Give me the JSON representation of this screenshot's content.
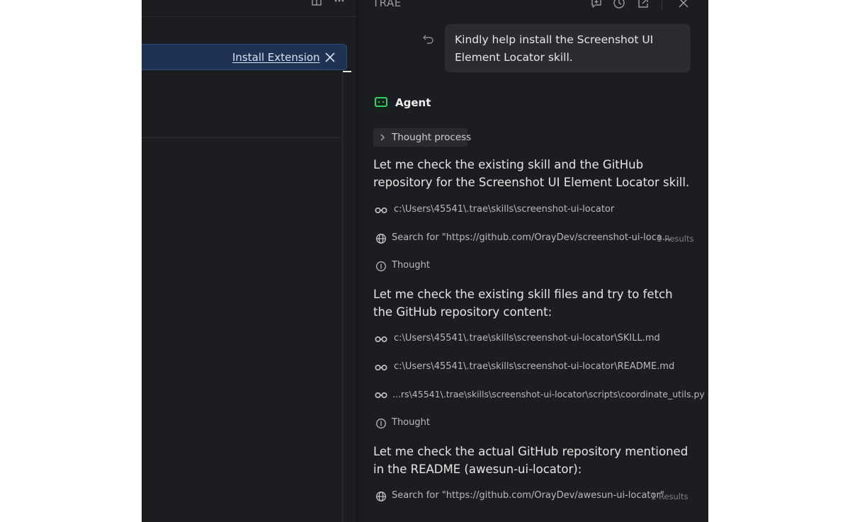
{
  "banner": {
    "link_label": "Install Extension"
  },
  "chat": {
    "title": "TRAE",
    "header_icons": [
      "new-chat-icon",
      "history-icon",
      "open-external-icon",
      "close-icon"
    ],
    "user_message": "Kindly help install the Screenshot UI Element Locator skill.",
    "agent_name": "Agent",
    "thought_process_label": "Thought process",
    "blocks": {
      "p1": "Let me check the existing skill and the GitHub repository for the Screenshot UI Element Locator skill.",
      "read1": "c:\\Users\\45541\\.trae\\skills\\screenshot-ui-locator",
      "search1": "Search for \"https://github.com/OrayDev/screenshot-ui-loca...",
      "search1_results": "1 Results",
      "thought1": "Thought",
      "p2": "Let me check the existing skill files and try to fetch the GitHub repository content:",
      "read2": "c:\\Users\\45541\\.trae\\skills\\screenshot-ui-locator\\SKILL.md",
      "read3": "c:\\Users\\45541\\.trae\\skills\\screenshot-ui-locator\\README.md",
      "read4": "...rs\\45541\\.trae\\skills\\screenshot-ui-locator\\scripts\\coordinate_utils.py",
      "thought2": "Thought",
      "p3": "Let me check the actual GitHub repository mentioned in the README (awesun-ui-locator):",
      "search2": "Search for \"https://github.com/OrayDev/awesun-ui-locator\"",
      "search2_results": "1 Results"
    }
  },
  "colors": {
    "background": "#1c1d20",
    "banner": "#1e3253",
    "user_bubble": "#2b2c30",
    "agent_accent": "#2ecc71"
  }
}
